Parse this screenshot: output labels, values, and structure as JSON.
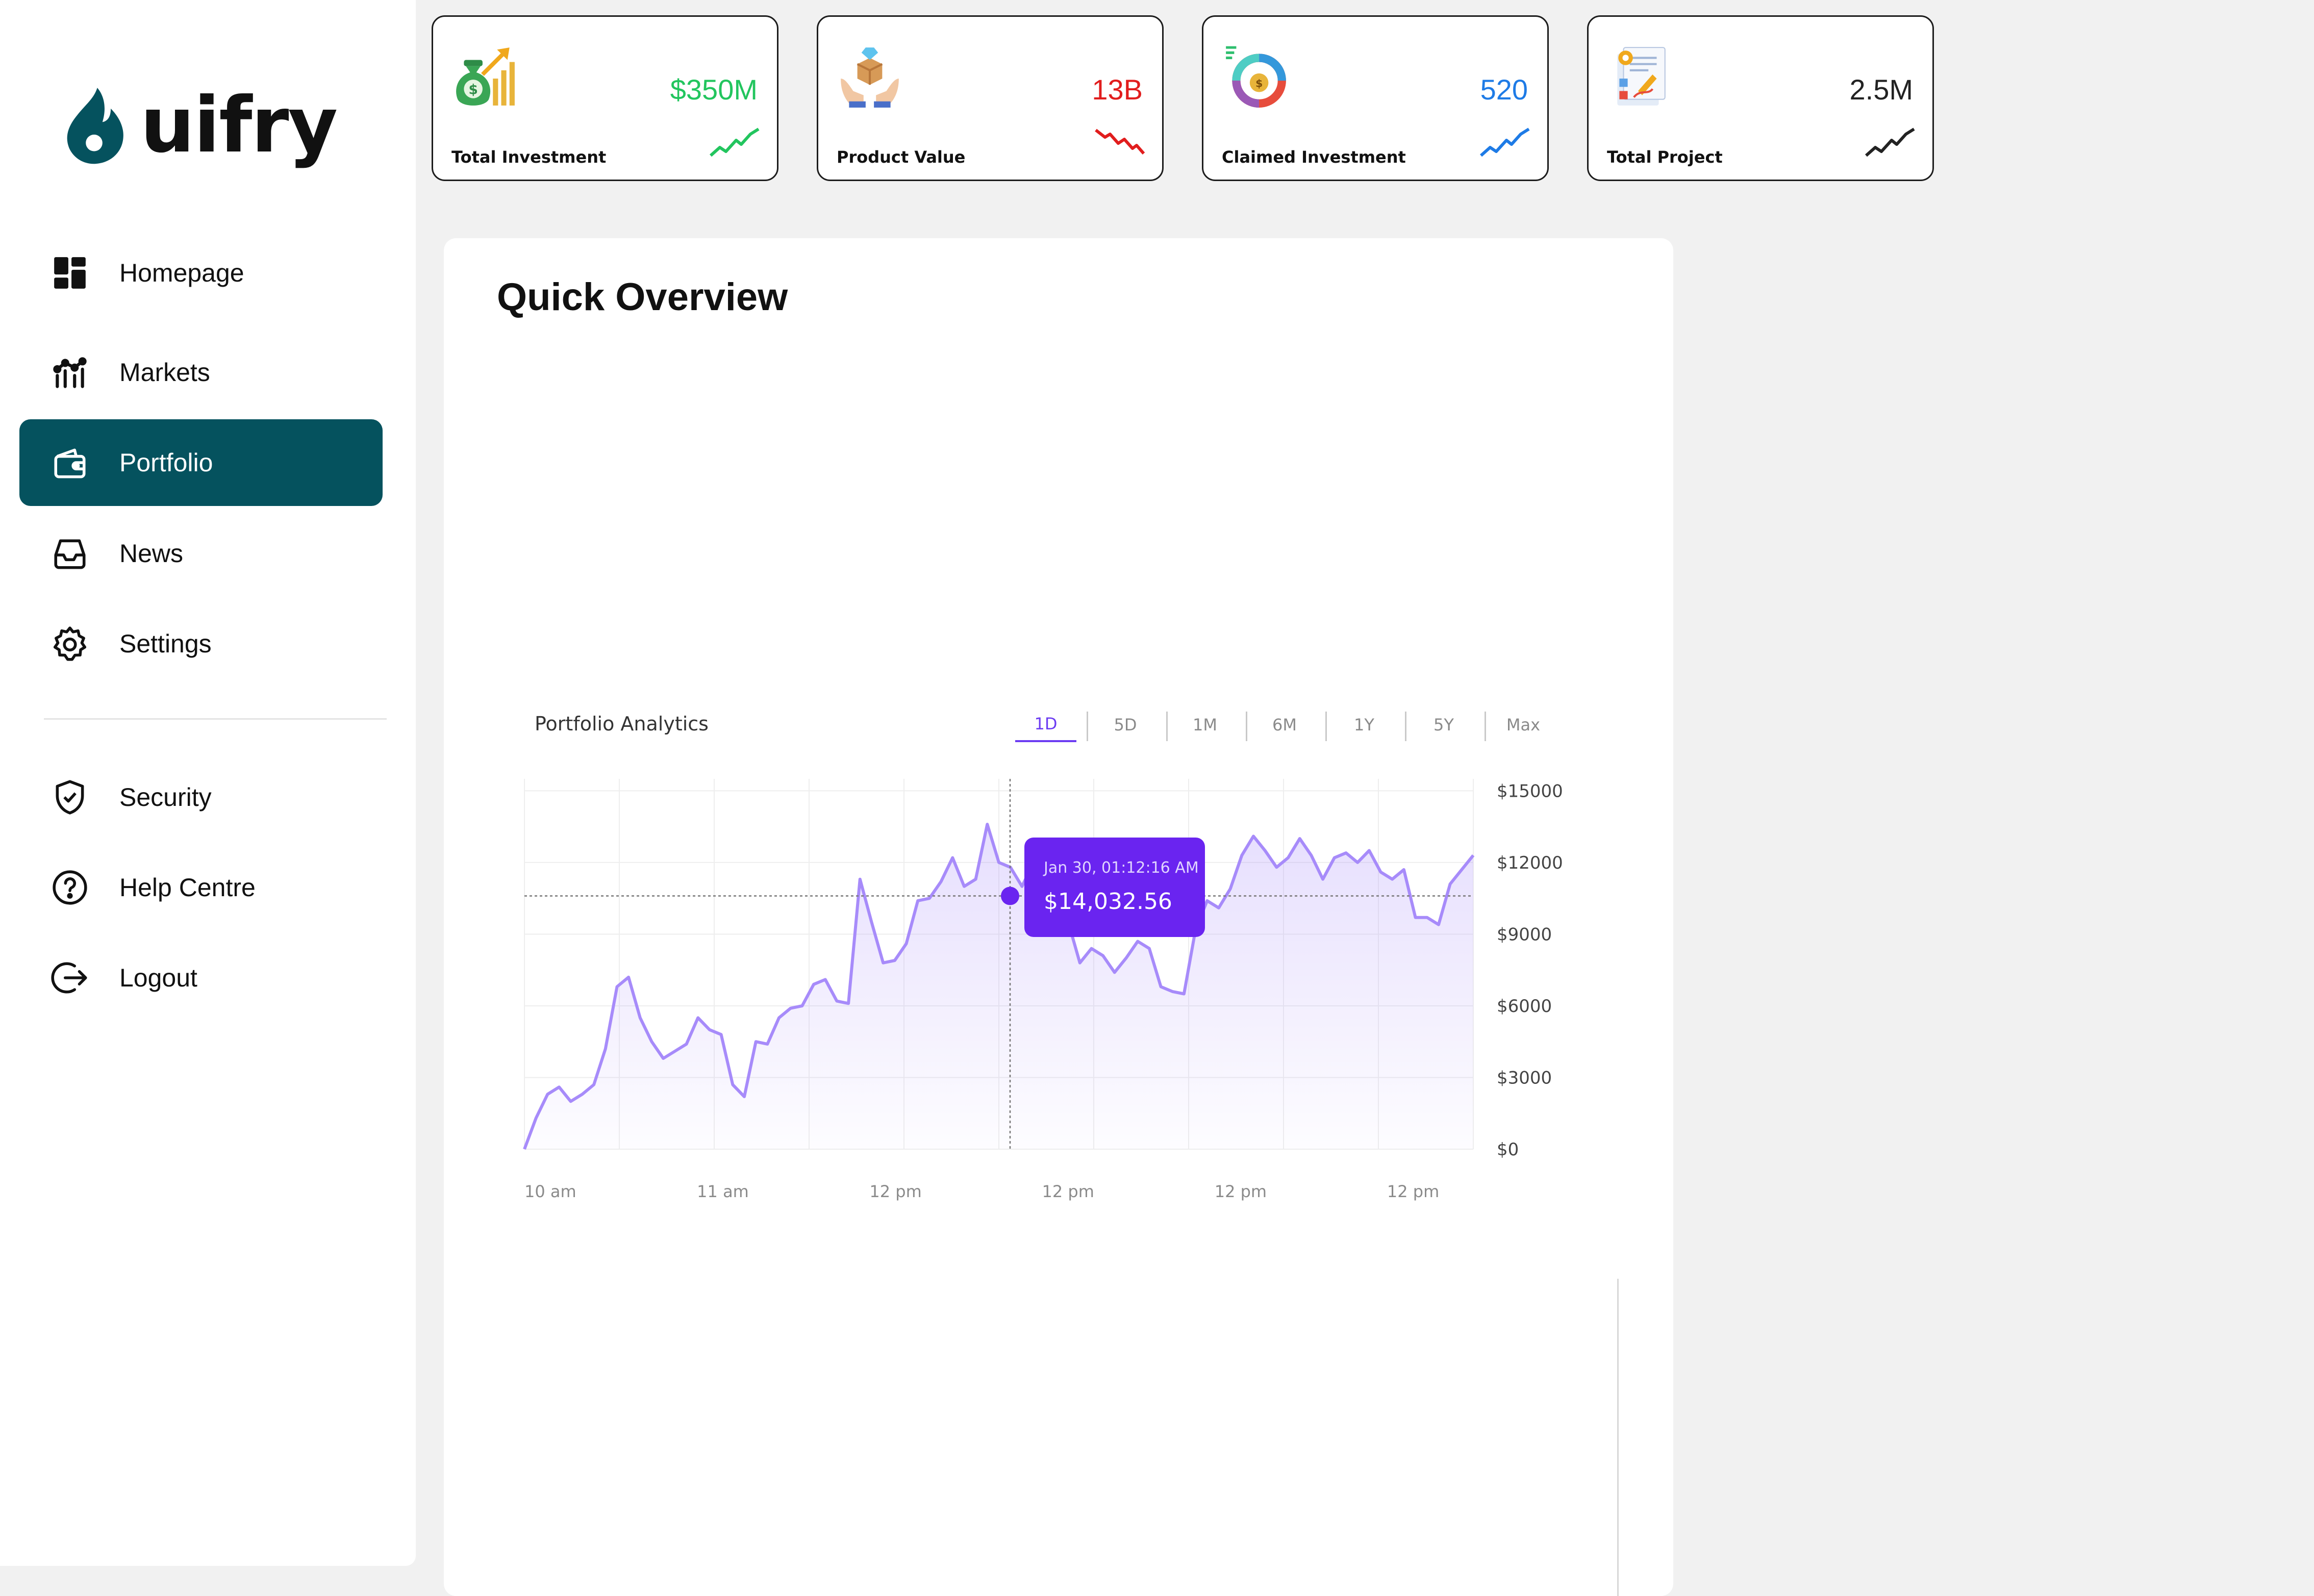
{
  "brand": {
    "name": "uifry",
    "color": "#05525e"
  },
  "sidebar": {
    "items": [
      {
        "label": "Homepage",
        "icon": "dashboard-icon"
      },
      {
        "label": "Markets",
        "icon": "markets-chart-icon"
      },
      {
        "label": "Portfolio",
        "icon": "wallet-icon",
        "active": true
      },
      {
        "label": "News",
        "icon": "inbox-icon"
      },
      {
        "label": "Settings",
        "icon": "gear-icon"
      }
    ],
    "secondary_items": [
      {
        "label": "Security",
        "icon": "shield-check-icon"
      },
      {
        "label": "Help Centre",
        "icon": "help-circle-icon"
      },
      {
        "label": "Logout",
        "icon": "logout-icon"
      }
    ]
  },
  "stats": [
    {
      "label": "Total Investment",
      "value": "$350M",
      "value_color": "#22c55e",
      "trend": "up",
      "icon": "money-bag-growth-icon"
    },
    {
      "label": "Product Value",
      "value": "13B",
      "value_color": "#e11d1d",
      "trend": "down",
      "icon": "hands-box-icon"
    },
    {
      "label": "Claimed Investment",
      "value": "520",
      "value_color": "#1e7be6",
      "trend": "up",
      "icon": "donut-money-icon"
    },
    {
      "label": "Total Project",
      "value": "2.5M",
      "value_color": "#222222",
      "trend": "up",
      "icon": "project-document-icon"
    }
  ],
  "overview": {
    "title": "Quick Overview",
    "chart_title": "Portfolio Analytics",
    "ranges": [
      "1D",
      "5D",
      "1M",
      "6M",
      "1Y",
      "5Y",
      "Max"
    ],
    "active_range": "1D",
    "tooltip": {
      "date": "Jan 30, 01:12:16 AM",
      "value": "$14,032.56"
    }
  },
  "chart_data": {
    "type": "area",
    "line_color": "#a78bfa",
    "accent_color": "#6a24f0",
    "ylim": [
      0,
      15500
    ],
    "yticks": [
      "$15000",
      "$12000",
      "$9000",
      "$6000",
      "$3000",
      "$0"
    ],
    "ytick_values": [
      15000,
      12000,
      9000,
      6000,
      3000,
      0
    ],
    "xticks": [
      "10 am",
      "11 am",
      "12 pm",
      "12 pm",
      "12 pm",
      "12 pm"
    ],
    "crosshair_value": 10600,
    "values": [
      0,
      1300,
      2300,
      2600,
      2000,
      2300,
      2700,
      4200,
      6800,
      7200,
      5500,
      4500,
      3800,
      4100,
      4400,
      5500,
      5000,
      4800,
      2700,
      2200,
      4500,
      4400,
      5500,
      5900,
      6000,
      6900,
      7100,
      6200,
      6100,
      11300,
      9500,
      7800,
      7900,
      8600,
      10400,
      10500,
      11200,
      12200,
      11000,
      11300,
      13600,
      12000,
      11800,
      11000,
      12000,
      9400,
      10600,
      9500,
      7800,
      8400,
      8100,
      7400,
      8000,
      8700,
      8400,
      6800,
      6600,
      6500,
      9200,
      10400,
      10100,
      10900,
      12300,
      13100,
      12500,
      11800,
      12200,
      13000,
      12300,
      11300,
      12200,
      12400,
      12000,
      12500,
      11600,
      11300,
      11700,
      9700,
      9700,
      9400,
      11100,
      11700,
      12300
    ]
  }
}
